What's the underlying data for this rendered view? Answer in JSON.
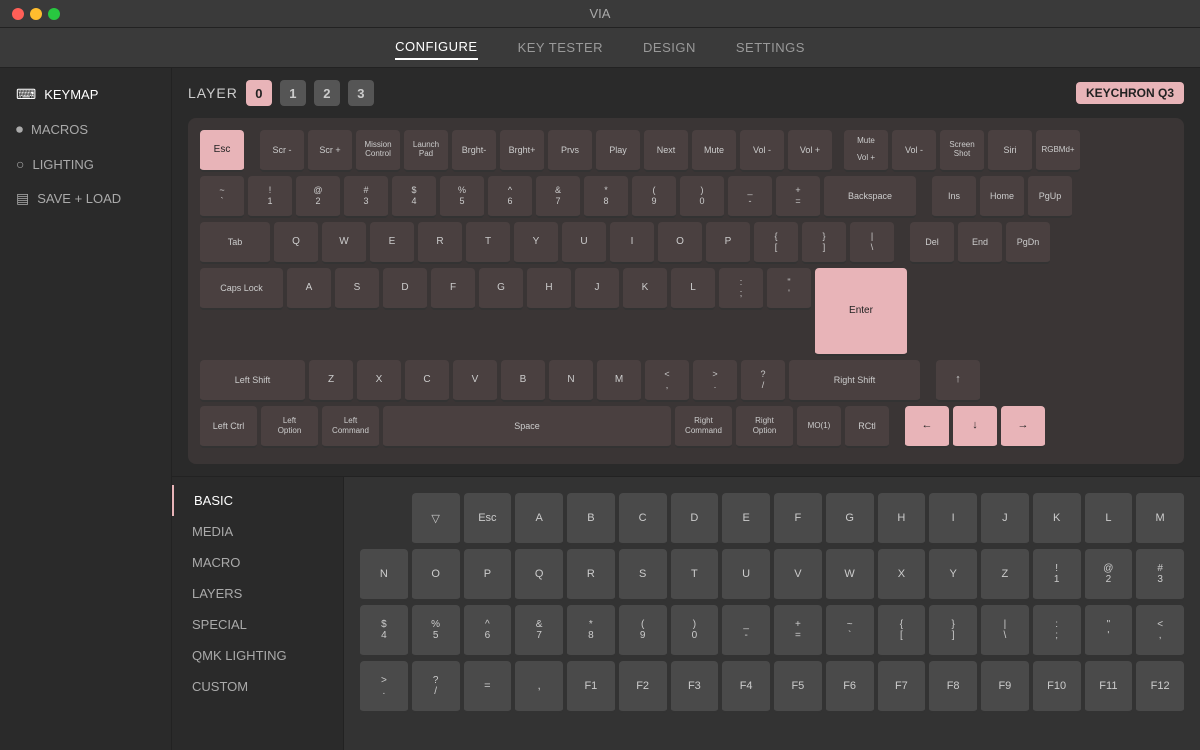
{
  "titlebar": {
    "title": "VIA"
  },
  "navbar": {
    "items": [
      {
        "label": "CONFIGURE",
        "active": true
      },
      {
        "label": "KEY TESTER",
        "active": false
      },
      {
        "label": "DESIGN",
        "active": false
      },
      {
        "label": "SETTINGS",
        "active": false
      }
    ]
  },
  "sidebar": {
    "items": [
      {
        "label": "KEYMAP",
        "icon": "⌨",
        "active": true
      },
      {
        "label": "MACROS",
        "icon": "⏺"
      },
      {
        "label": "LIGHTING",
        "icon": "💡"
      },
      {
        "label": "SAVE + LOAD",
        "icon": "💾"
      }
    ]
  },
  "layer": {
    "label": "LAYER",
    "buttons": [
      "0",
      "1",
      "2",
      "3"
    ]
  },
  "keyboard_model": "KEYCHRON Q3",
  "keyboard": {
    "row1": [
      {
        "label": "Esc",
        "width": "w1",
        "highlight": true
      },
      {
        "label": "Scr -",
        "width": "w1"
      },
      {
        "label": "Scr +",
        "width": "w1"
      },
      {
        "label": "Mission\nControl",
        "width": "w1"
      },
      {
        "label": "Launch\nPad",
        "width": "w1"
      },
      {
        "label": "Brght-",
        "width": "w1"
      },
      {
        "label": "Brght+",
        "width": "w1"
      },
      {
        "label": "Prvs",
        "width": "w1"
      },
      {
        "label": "Play",
        "width": "w1"
      },
      {
        "label": "Next",
        "width": "w1"
      },
      {
        "label": "Mute",
        "width": "w1"
      },
      {
        "label": "Vol -",
        "width": "w1"
      },
      {
        "label": "Vol +",
        "width": "w1"
      },
      {
        "label": "Mute\n\nVol +",
        "width": "w1"
      },
      {
        "label": "Vol -",
        "width": "w1"
      },
      {
        "label": "Screen\nShot",
        "width": "w1"
      },
      {
        "label": "Siri",
        "width": "w1"
      },
      {
        "label": "RGBMd+",
        "width": "w1"
      }
    ],
    "row2": [
      {
        "label": "~\n`",
        "width": "w1"
      },
      {
        "label": "!\n1",
        "width": "w1"
      },
      {
        "label": "@\n2",
        "width": "w1"
      },
      {
        "label": "#\n3",
        "width": "w1"
      },
      {
        "label": "$\n4",
        "width": "w1"
      },
      {
        "label": "%\n5",
        "width": "w1"
      },
      {
        "label": "^\n6",
        "width": "w1"
      },
      {
        "label": "&\n7",
        "width": "w1"
      },
      {
        "label": "*\n8",
        "width": "w1"
      },
      {
        "label": "(\n9",
        "width": "w1"
      },
      {
        "label": ")\n0",
        "width": "w1"
      },
      {
        "label": "_\n-",
        "width": "w1"
      },
      {
        "label": "+\n=",
        "width": "w1"
      },
      {
        "label": "Backspace",
        "width": "w2"
      },
      {
        "label": "Ins",
        "width": "w1"
      },
      {
        "label": "Home",
        "width": "w1"
      },
      {
        "label": "PgUp",
        "width": "w1"
      }
    ],
    "row3": [
      {
        "label": "Tab",
        "width": "w150"
      },
      {
        "label": "Q",
        "width": "w1"
      },
      {
        "label": "W",
        "width": "w1"
      },
      {
        "label": "E",
        "width": "w1"
      },
      {
        "label": "R",
        "width": "w1"
      },
      {
        "label": "T",
        "width": "w1"
      },
      {
        "label": "Y",
        "width": "w1"
      },
      {
        "label": "U",
        "width": "w1"
      },
      {
        "label": "I",
        "width": "w1"
      },
      {
        "label": "O",
        "width": "w1"
      },
      {
        "label": "P",
        "width": "w1"
      },
      {
        "label": "{\n[",
        "width": "w1"
      },
      {
        "label": "}\n]",
        "width": "w1"
      },
      {
        "label": "|\n\\",
        "width": "w1"
      },
      {
        "label": "Del",
        "width": "w1"
      },
      {
        "label": "End",
        "width": "w1"
      },
      {
        "label": "PgDn",
        "width": "w1"
      }
    ],
    "row4": [
      {
        "label": "Caps Lock",
        "width": "w175"
      },
      {
        "label": "A",
        "width": "w1"
      },
      {
        "label": "S",
        "width": "w1"
      },
      {
        "label": "D",
        "width": "w1"
      },
      {
        "label": "F",
        "width": "w1"
      },
      {
        "label": "G",
        "width": "w1"
      },
      {
        "label": "H",
        "width": "w1"
      },
      {
        "label": "J",
        "width": "w1"
      },
      {
        "label": "K",
        "width": "w1"
      },
      {
        "label": "L",
        "width": "w1"
      },
      {
        "label": ":\n;",
        "width": "w1"
      },
      {
        "label": "\"\n'",
        "width": "w1"
      },
      {
        "label": "Enter",
        "width": "w-enter",
        "highlight": true
      }
    ],
    "row5": [
      {
        "label": "Left Shift",
        "width": "w225"
      },
      {
        "label": "Z",
        "width": "w1"
      },
      {
        "label": "X",
        "width": "w1"
      },
      {
        "label": "C",
        "width": "w1"
      },
      {
        "label": "V",
        "width": "w1"
      },
      {
        "label": "B",
        "width": "w1"
      },
      {
        "label": "N",
        "width": "w1"
      },
      {
        "label": "M",
        "width": "w1"
      },
      {
        "label": "<\n,",
        "width": "w1"
      },
      {
        "label": ">\n.",
        "width": "w1"
      },
      {
        "label": "?\n/",
        "width": "w1"
      },
      {
        "label": "Right Shift",
        "width": "w275"
      }
    ],
    "row6": [
      {
        "label": "Left Ctrl",
        "width": "w125"
      },
      {
        "label": "Left\nOption",
        "width": "w125"
      },
      {
        "label": "Left\nCommand",
        "width": "w125"
      },
      {
        "label": "Space",
        "width": "w625"
      },
      {
        "label": "Right\nCommand",
        "width": "w125"
      },
      {
        "label": "Right\nOption",
        "width": "w125"
      },
      {
        "label": "MO(1)",
        "width": "w1"
      },
      {
        "label": "RCtl",
        "width": "w1"
      }
    ]
  },
  "bottom_sidebar": {
    "items": [
      {
        "label": "BASIC",
        "active": true
      },
      {
        "label": "MEDIA"
      },
      {
        "label": "MACRO"
      },
      {
        "label": "LAYERS"
      },
      {
        "label": "SPECIAL"
      },
      {
        "label": "QMK LIGHTING"
      },
      {
        "label": "CUSTOM"
      }
    ]
  },
  "picker_rows": [
    [
      {
        "label": ""
      },
      {
        "label": "▽"
      },
      {
        "label": "Esc"
      },
      {
        "label": "A"
      },
      {
        "label": "B"
      },
      {
        "label": "C"
      },
      {
        "label": "D"
      },
      {
        "label": "E"
      },
      {
        "label": "F"
      },
      {
        "label": "G"
      },
      {
        "label": "H"
      },
      {
        "label": "I"
      },
      {
        "label": "J"
      },
      {
        "label": "K"
      },
      {
        "label": "L"
      },
      {
        "label": "M"
      }
    ],
    [
      {
        "label": "N"
      },
      {
        "label": "O"
      },
      {
        "label": "P"
      },
      {
        "label": "Q"
      },
      {
        "label": "R"
      },
      {
        "label": "S"
      },
      {
        "label": "T"
      },
      {
        "label": "U"
      },
      {
        "label": "V"
      },
      {
        "label": "W"
      },
      {
        "label": "X"
      },
      {
        "label": "Y"
      },
      {
        "label": "Z"
      },
      {
        "label": "!\n1"
      },
      {
        "label": "@\n2"
      },
      {
        "label": "#\n3"
      }
    ],
    [
      {
        "label": "$\n4"
      },
      {
        "label": "%\n5"
      },
      {
        "label": "^\n6"
      },
      {
        "label": "&\n7"
      },
      {
        "label": "*\n8"
      },
      {
        "label": "(\n9"
      },
      {
        "label": ")\n0"
      },
      {
        "label": "_\n-"
      },
      {
        "label": "+\n="
      },
      {
        "label": "~\n`"
      },
      {
        "label": "{\n["
      },
      {
        "label": "}\n]"
      },
      {
        "label": "|\n\\"
      },
      {
        "label": ":\n;"
      },
      {
        "label": "\"\n'"
      },
      {
        "label": "<\n,"
      }
    ],
    [
      {
        "label": ">\n."
      },
      {
        "label": "?\n/"
      },
      {
        "label": "="
      },
      {
        "label": ","
      },
      {
        "label": "F1"
      },
      {
        "label": "F2"
      },
      {
        "label": "F3"
      },
      {
        "label": "F4"
      },
      {
        "label": "F5"
      },
      {
        "label": "F6"
      },
      {
        "label": "F7"
      },
      {
        "label": "F8"
      },
      {
        "label": "F9"
      },
      {
        "label": "F10"
      },
      {
        "label": "F11"
      },
      {
        "label": "F12"
      }
    ]
  ]
}
